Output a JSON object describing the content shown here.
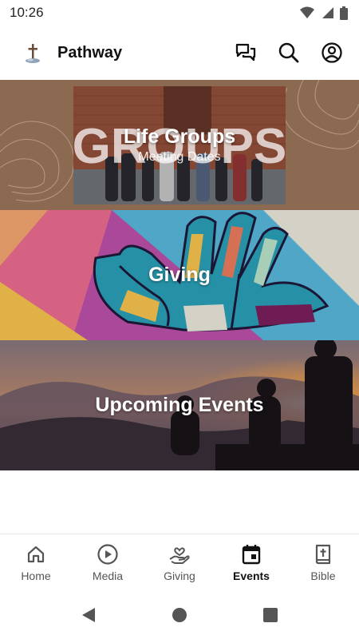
{
  "status_bar": {
    "time": "10:26",
    "icons": [
      "wifi-icon",
      "signal-icon",
      "battery-icon"
    ]
  },
  "header": {
    "title": "Pathway",
    "actions": [
      "chat-icon",
      "search-icon",
      "account-icon"
    ]
  },
  "tiles": [
    {
      "title": "Life Groups",
      "subtitle": "Meeting Dates",
      "background_word": "GROUPS"
    },
    {
      "title": "Giving"
    },
    {
      "title": "Upcoming Events"
    }
  ],
  "bottom_nav": {
    "items": [
      {
        "label": "Home",
        "icon": "home-icon",
        "active": false
      },
      {
        "label": "Media",
        "icon": "play-circle-icon",
        "active": false
      },
      {
        "label": "Giving",
        "icon": "giving-hand-icon",
        "active": false
      },
      {
        "label": "Events",
        "icon": "calendar-icon",
        "active": true
      },
      {
        "label": "Bible",
        "icon": "bible-icon",
        "active": false
      }
    ]
  },
  "colors": {
    "groups_bg": "#8c6a52",
    "accent_text": "#111111",
    "inactive_text": "#555555"
  }
}
